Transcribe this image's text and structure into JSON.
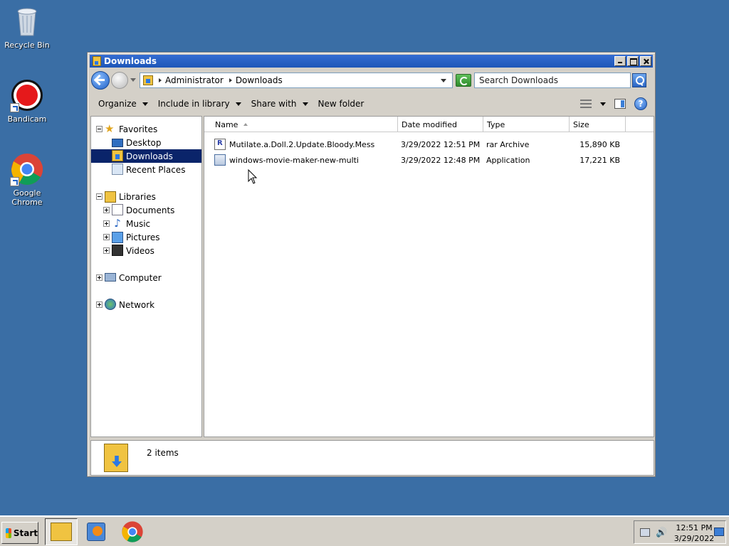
{
  "desktop": {
    "icons": [
      {
        "label": "Recycle Bin",
        "icon": "recycle-bin-icon"
      },
      {
        "label": "Bandicam",
        "icon": "bandicam-icon"
      },
      {
        "label": "Google Chrome",
        "icon": "chrome-icon"
      }
    ]
  },
  "window": {
    "title": "Downloads",
    "address": {
      "crumbs": [
        "Administrator",
        "Downloads"
      ],
      "search_placeholder": "Search Downloads"
    },
    "toolbar": {
      "organize": "Organize",
      "include_in_library": "Include in library",
      "share_with": "Share with",
      "new_folder": "New folder"
    },
    "nav": {
      "favorites": "Favorites",
      "desktop": "Desktop",
      "downloads": "Downloads",
      "recent_places": "Recent Places",
      "libraries": "Libraries",
      "documents": "Documents",
      "music": "Music",
      "pictures": "Pictures",
      "videos": "Videos",
      "computer": "Computer",
      "network": "Network"
    },
    "columns": {
      "name": "Name",
      "date_modified": "Date modified",
      "type": "Type",
      "size": "Size"
    },
    "files": [
      {
        "name": "Mutilate.a.Doll.2.Update.Bloody.Mess",
        "date": "3/29/2022 12:51 PM",
        "type": "rar Archive",
        "size": "15,890 KB",
        "icon": "rar-archive-icon"
      },
      {
        "name": "windows-movie-maker-new-multi",
        "date": "3/29/2022 12:48 PM",
        "type": "Application",
        "size": "17,221 KB",
        "icon": "application-icon"
      }
    ],
    "details": {
      "count": "2 items"
    }
  },
  "taskbar": {
    "start_label": "Start",
    "clock_time": "12:51 PM",
    "clock_date": "3/29/2022"
  }
}
